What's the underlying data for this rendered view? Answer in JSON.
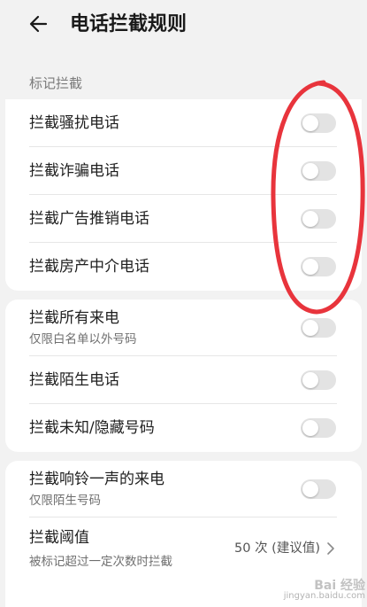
{
  "header": {
    "title": "电话拦截规则",
    "back_icon": "arrow-left-icon"
  },
  "section": {
    "label": "标记拦截"
  },
  "marked_rules": [
    {
      "label": "拦截骚扰电话",
      "enabled": false
    },
    {
      "label": "拦截诈骗电话",
      "enabled": false
    },
    {
      "label": "拦截广告推销电话",
      "enabled": false
    },
    {
      "label": "拦截房产中介电话",
      "enabled": false
    }
  ],
  "general_rules": [
    {
      "label": "拦截所有来电",
      "sublabel": "仅限白名单以外号码",
      "enabled": false
    },
    {
      "label": "拦截陌生电话",
      "enabled": false
    },
    {
      "label": "拦截未知/隐藏号码",
      "enabled": false
    }
  ],
  "ring_rule": {
    "label": "拦截响铃一声的来电",
    "sublabel": "仅限陌生号码",
    "enabled": false
  },
  "threshold": {
    "label": "拦截阈值",
    "sublabel": "被标记超过一定次数时拦截",
    "value": "50 次 (建议值)",
    "chevron_icon": "chevron-right-icon"
  },
  "watermark": {
    "brand": "Bai 经验",
    "url": "jingyan.baidu.com"
  },
  "colors": {
    "toggle_off": "#e3e3e3",
    "annotation": "#e8343c",
    "background": "#f2f2f2",
    "card": "#ffffff"
  }
}
